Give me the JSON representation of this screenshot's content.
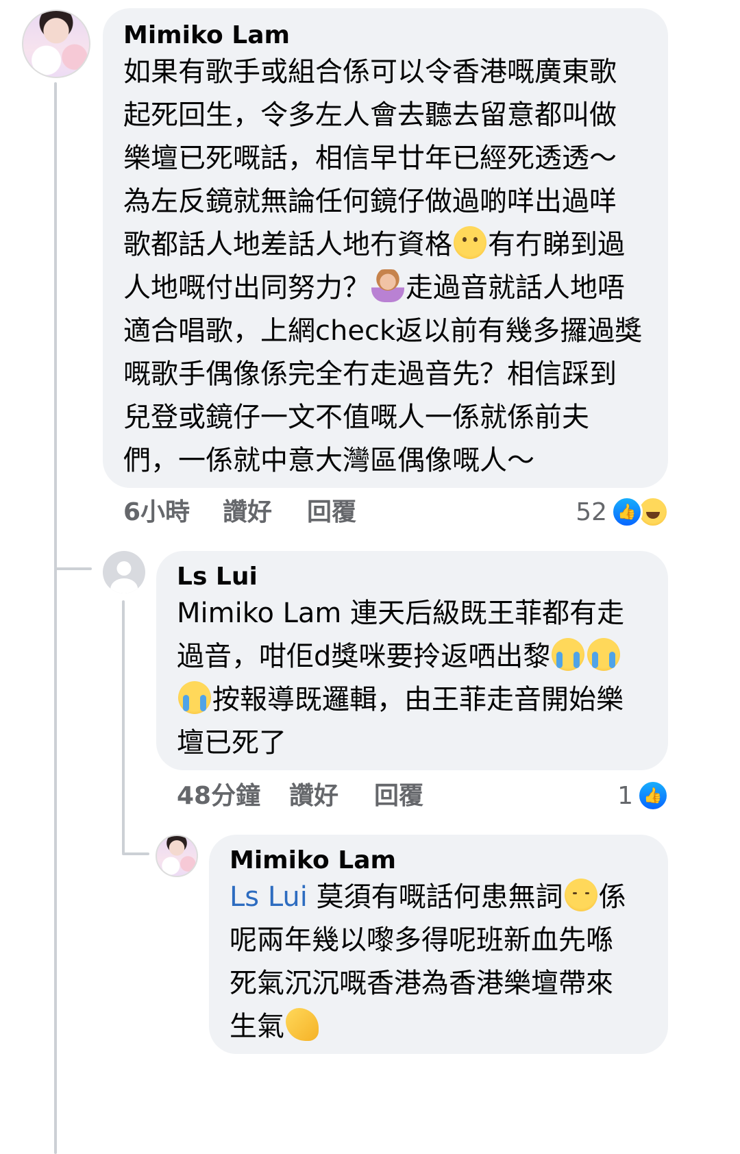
{
  "comments": [
    {
      "author": "Mimiko Lam",
      "lines": [
        "如果有歌手或組合係可以令香港嘅廣東歌",
        "起死回生，令多左人會去聽去留意都叫做",
        "樂壇已死嘅話，相信早廿年已經死透透～",
        "為左反鏡就無論任何鏡仔做過啲咩出過咩",
        "歌都話人地差話人地冇資格",
        "有冇睇到過",
        "人地嘅付出同努力？",
        "走過音就話人地唔",
        "適合唱歌，上網check返以前有幾多攞過獎",
        "嘅歌手偶像係完全冇走過音先？相信踩到",
        "兒登或鏡仔一文不值嘅人一係就係前夫",
        "們，一係就中意大灣區偶像嘅人～"
      ],
      "time": "6小時",
      "like_label": "讚好",
      "reply_label": "回覆",
      "reaction_count": "52",
      "reactions": [
        "like",
        "haha"
      ],
      "emojis": [
        "face-with-raised-eyebrow",
        "person-shrugging"
      ]
    },
    {
      "author": "Ls Lui",
      "lines": [
        "Mimiko Lam 連天后級既王菲都有走",
        "過音，咁佢d獎咪要拎返哂出黎",
        "按報導既邏輯，由王菲走音開始樂",
        "壇已死了"
      ],
      "time": "48分鐘",
      "like_label": "讚好",
      "reply_label": "回覆",
      "reaction_count": "1",
      "reactions": [
        "like"
      ],
      "emojis": [
        "loudly-crying-face",
        "loudly-crying-face",
        "loudly-crying-face"
      ]
    },
    {
      "author": "Mimiko Lam",
      "mention": "Ls Lui",
      "lines": [
        " 莫須有嘅話何患無詞",
        "係",
        "呢兩年幾以嚟多得呢班新血先喺",
        "死氣沉沉嘅香港為香港樂壇帶來",
        "生氣"
      ],
      "emojis": [
        "pensive-face",
        "flexed-biceps"
      ]
    }
  ]
}
